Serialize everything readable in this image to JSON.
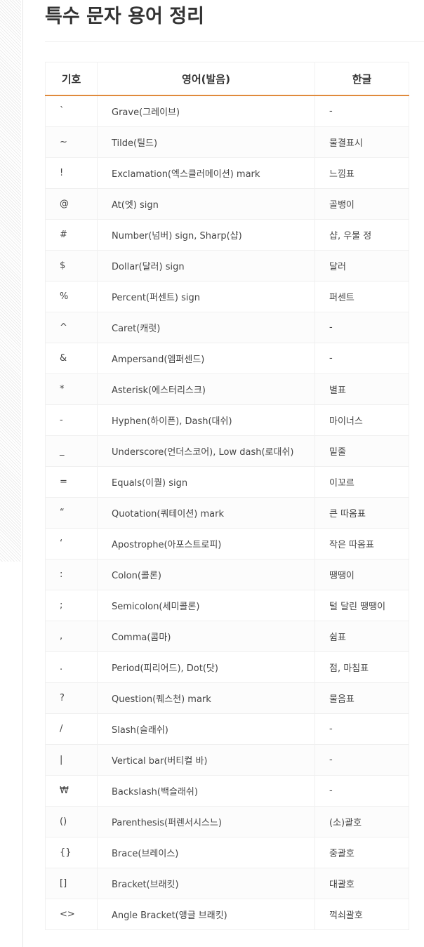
{
  "page": {
    "title": "특수 문자 용어 정리"
  },
  "colors": {
    "accent": "#e08a3c",
    "text": "#444444",
    "heading": "#333333"
  },
  "table": {
    "headers": [
      "기호",
      "영어(발음)",
      "한글"
    ],
    "rows": [
      {
        "symbol": "`",
        "english": "Grave(그레이브)",
        "korean": "-"
      },
      {
        "symbol": "~",
        "english": "Tilde(틸드)",
        "korean": "물결표시"
      },
      {
        "symbol": "!",
        "english": "Exclamation(엑스클러메이션) mark",
        "korean": "느낌표"
      },
      {
        "symbol": "@",
        "english": "At(엣) sign",
        "korean": "골뱅이"
      },
      {
        "symbol": "#",
        "english": "Number(넘버) sign, Sharp(샵)",
        "korean": "샵, 우물 정"
      },
      {
        "symbol": "$",
        "english": "Dollar(달러) sign",
        "korean": "달러"
      },
      {
        "symbol": "%",
        "english": "Percent(퍼센트) sign",
        "korean": "퍼센트"
      },
      {
        "symbol": "^",
        "english": "Caret(캐럿)",
        "korean": "-"
      },
      {
        "symbol": "&",
        "english": "Ampersand(엠퍼센드)",
        "korean": "-"
      },
      {
        "symbol": "*",
        "english": "Asterisk(에스터리스크)",
        "korean": "별표"
      },
      {
        "symbol": "-",
        "english": "Hyphen(하이픈), Dash(대쉬)",
        "korean": "마이너스"
      },
      {
        "symbol": "_",
        "english": "Underscore(언더스코어), Low dash(로대쉬)",
        "korean": "밑줄"
      },
      {
        "symbol": "=",
        "english": "Equals(이퀄) sign",
        "korean": "이꼬르"
      },
      {
        "symbol": "“",
        "english": "Quotation(쿼테이션) mark",
        "korean": "큰 따옴표"
      },
      {
        "symbol": "‘",
        "english": "Apostrophe(아포스트로피)",
        "korean": "작은 따옴표"
      },
      {
        "symbol": ":",
        "english": "Colon(콜론)",
        "korean": "땡땡이"
      },
      {
        "symbol": ";",
        "english": "Semicolon(세미콜론)",
        "korean": "털 달린 땡땡이"
      },
      {
        "symbol": ",",
        "english": "Comma(콤마)",
        "korean": "쉼표"
      },
      {
        "symbol": ".",
        "english": "Period(피리어드), Dot(닷)",
        "korean": "점, 마침표"
      },
      {
        "symbol": "?",
        "english": "Question(퀘스천) mark",
        "korean": "물음표"
      },
      {
        "symbol": "/",
        "english": "Slash(슬래쉬)",
        "korean": "-"
      },
      {
        "symbol": "|",
        "english": "Vertical bar(버티컬 바)",
        "korean": "-"
      },
      {
        "symbol": "₩",
        "english": "Backslash(백슬래쉬)",
        "korean": "-"
      },
      {
        "symbol": "()",
        "english": "Parenthesis(퍼렌서시스느)",
        "korean": "(소)괄호"
      },
      {
        "symbol": "{}",
        "english": "Brace(브레이스)",
        "korean": "중괄호"
      },
      {
        "symbol": "[]",
        "english": "Bracket(브래킷)",
        "korean": "대괄호"
      },
      {
        "symbol": "<>",
        "english": "Angle Bracket(앵글 브래킷)",
        "korean": "꺽쇠괄호"
      }
    ]
  }
}
